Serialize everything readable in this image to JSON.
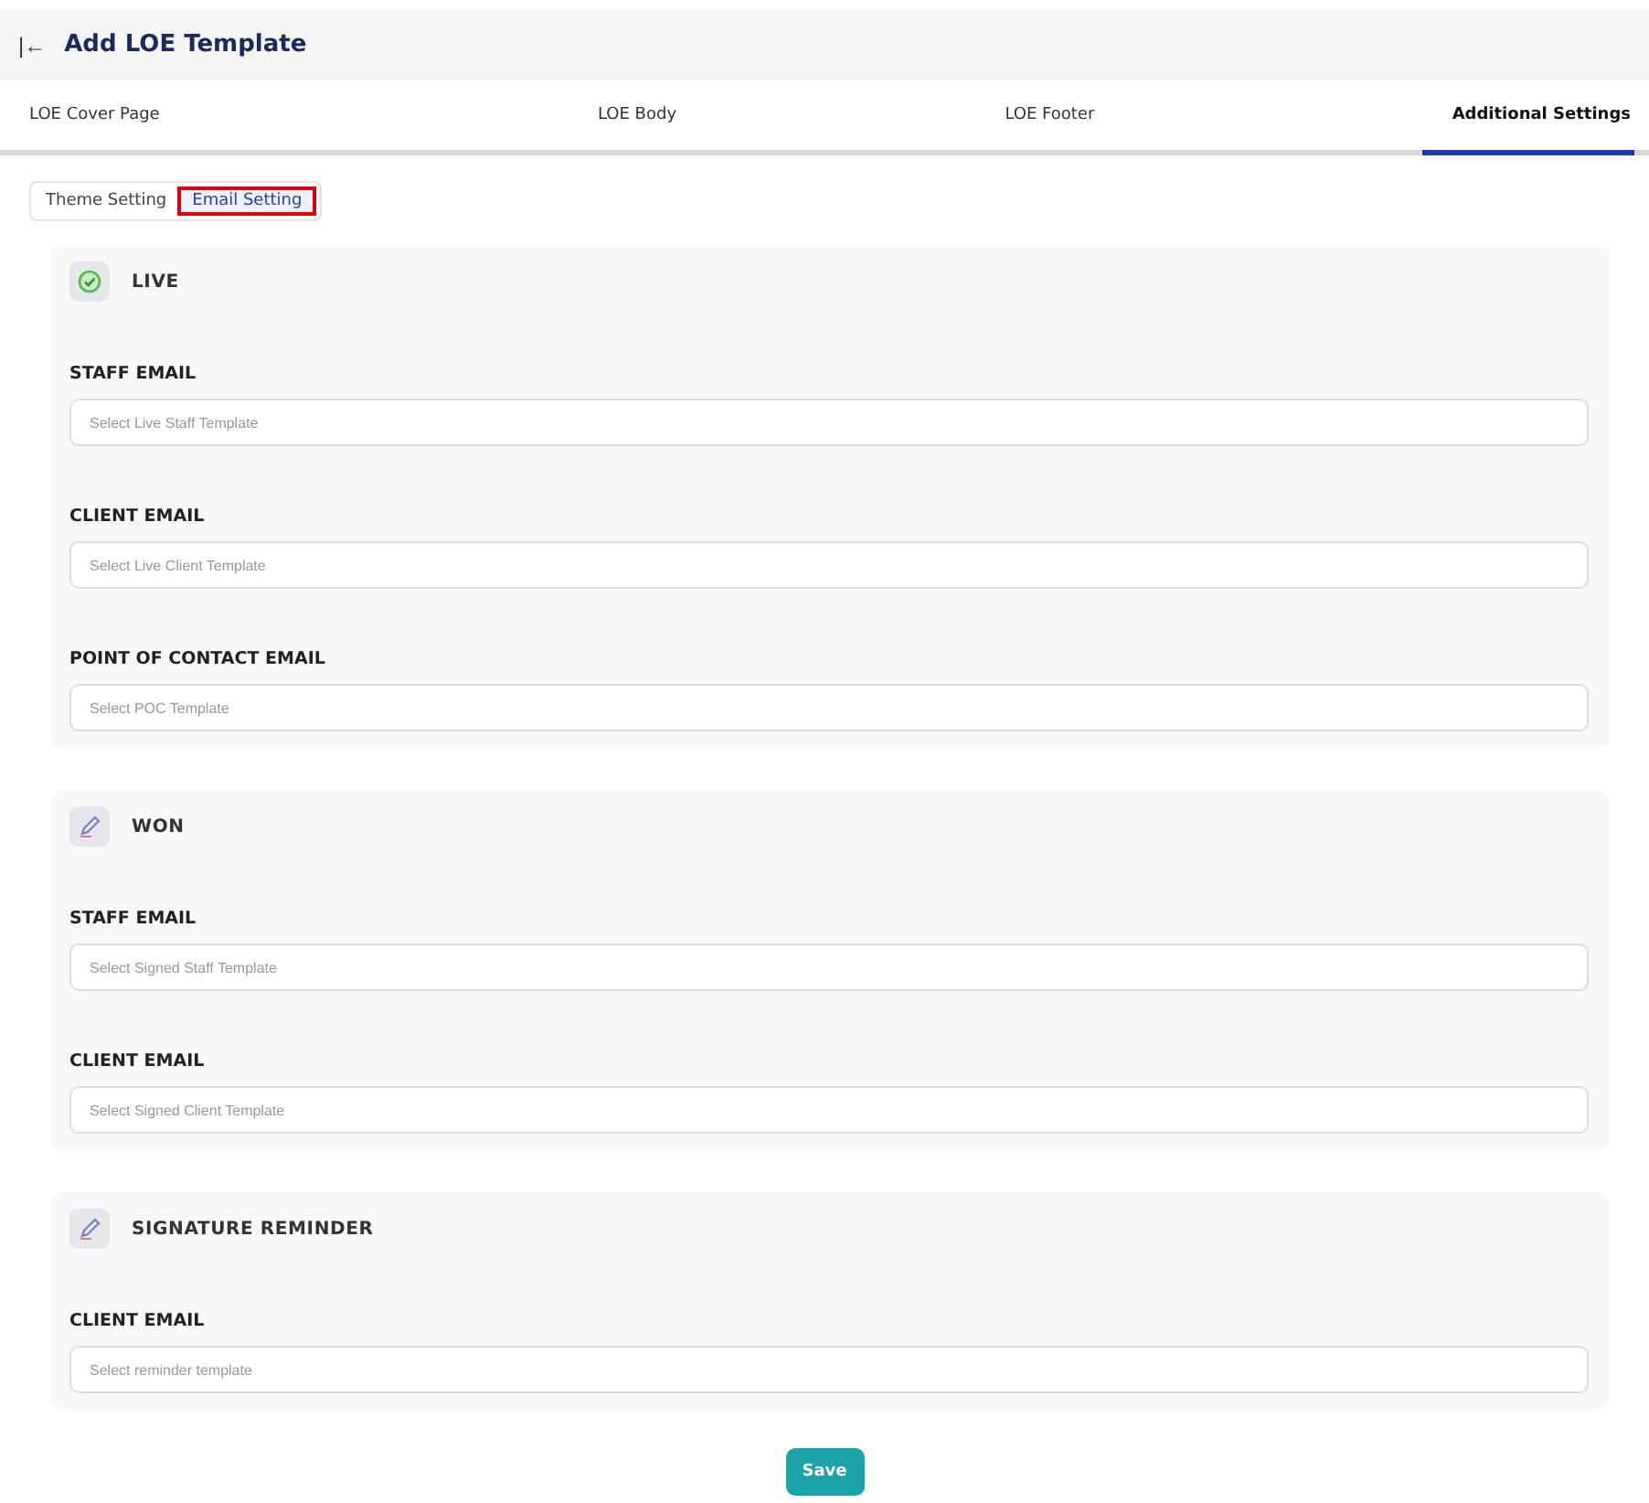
{
  "header": {
    "back": "|←",
    "title": "Add LOE Template"
  },
  "tabs": [
    {
      "label": "LOE Cover Page",
      "selected": false
    },
    {
      "label": "LOE Body",
      "selected": false
    },
    {
      "label": "LOE Footer",
      "selected": false
    },
    {
      "label": "Additional Settings",
      "selected": true
    }
  ],
  "subtabs": [
    {
      "label": "Theme Setting",
      "selected": false
    },
    {
      "label": "Email Setting",
      "selected": true
    }
  ],
  "sections": [
    {
      "kind": "live",
      "title": "LIVE",
      "fields": [
        {
          "label": "STAFF EMAIL",
          "placeholder": "Select Live Staff Template"
        },
        {
          "label": "CLIENT EMAIL",
          "placeholder": "Select Live Client Template"
        },
        {
          "label": "POINT OF CONTACT EMAIL",
          "placeholder": "Select POC Template"
        }
      ]
    },
    {
      "kind": "pen",
      "title": "WON",
      "fields": [
        {
          "label": "STAFF EMAIL",
          "placeholder": "Select Signed Staff Template"
        },
        {
          "label": "CLIENT EMAIL",
          "placeholder": "Select Signed Client Template"
        }
      ]
    },
    {
      "kind": "pen",
      "title": "SIGNATURE REMINDER",
      "fields": [
        {
          "label": "CLIENT EMAIL",
          "placeholder": "Select reminder template"
        }
      ]
    }
  ],
  "save_button": "Save"
}
